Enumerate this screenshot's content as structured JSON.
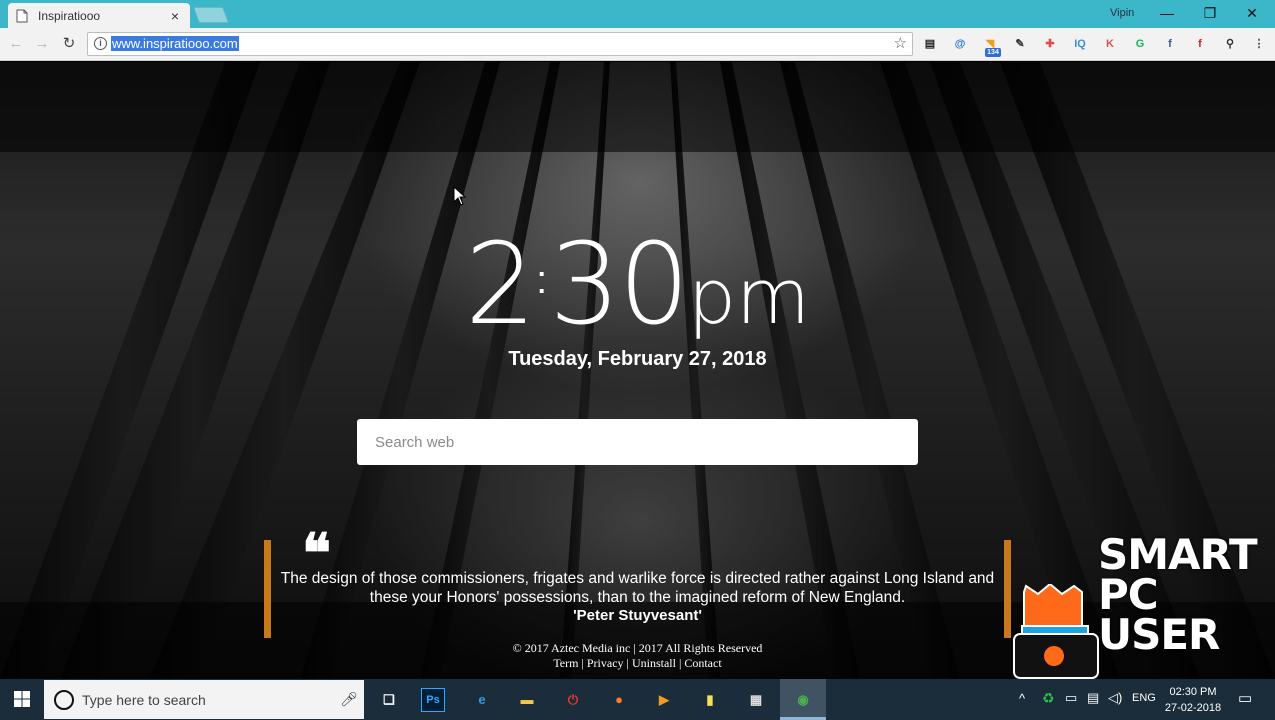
{
  "browser": {
    "tab_title": "Inspiratiooo",
    "tab_close": "×",
    "user_name": "Vipin",
    "window_controls": {
      "minimize": "—",
      "maximize": "❐",
      "close": "✕"
    },
    "url": "www.inspiratiooo.com",
    "extensions": [
      {
        "name": "layout-extension-icon",
        "glyph": "▤",
        "color": "#222222"
      },
      {
        "name": "at-extension-icon",
        "glyph": "@",
        "color": "#1e6fd9"
      },
      {
        "name": "rss-extension-icon",
        "glyph": "◥",
        "color": "#f0a01a",
        "badge": "134"
      },
      {
        "name": "eyedropper-extension-icon",
        "glyph": "✎",
        "color": "#333333"
      },
      {
        "name": "puzzle-extension-icon",
        "glyph": "✚",
        "color": "#e04a4a"
      },
      {
        "name": "iq-extension-icon",
        "glyph": "IQ",
        "color": "#3a8fd6"
      },
      {
        "name": "k-extension-icon",
        "glyph": "K",
        "color": "#e05050"
      },
      {
        "name": "grammarly-extension-icon",
        "glyph": "G",
        "color": "#16b35a"
      },
      {
        "name": "facebook-extension-icon",
        "glyph": "f",
        "color": "#3b5998"
      },
      {
        "name": "flipboard-extension-icon",
        "glyph": "f",
        "color": "#d42020"
      },
      {
        "name": "zoom-extension-icon",
        "glyph": "⚲",
        "color": "#333333"
      },
      {
        "name": "menu-icon",
        "glyph": "⋮",
        "color": "#444444"
      }
    ]
  },
  "page": {
    "clock": {
      "hour": "2",
      "colon": ":",
      "minutes": "30",
      "ampm": "pm"
    },
    "date": "Tuesday, February 27, 2018",
    "search_placeholder": "Search web",
    "quote_mark": "❝",
    "quote": "The design of those commissioners, frigates and warlike force is directed rather against Long Island and these your Honors' possessions, than to the imagined reform of New England.",
    "quote_author": "'Peter Stuyvesant'",
    "footer_copyright": "© 2017 Aztec Media inc | 2017 All Rights Reserved",
    "footer_links": [
      "Term",
      "Privacy",
      "Uninstall",
      "Contact"
    ],
    "footer_separator": " | ",
    "watermark_text": [
      "SMART",
      "PC USER"
    ]
  },
  "taskbar": {
    "search_placeholder": "Type here to search",
    "apps": [
      {
        "name": "task-view-icon",
        "glyph": "❑",
        "color": "#ffffff"
      },
      {
        "name": "photoshop-icon",
        "glyph": "Ps",
        "color": "#31a8ff"
      },
      {
        "name": "edge-icon",
        "glyph": "e",
        "color": "#3a96dd"
      },
      {
        "name": "file-explorer-icon",
        "glyph": "▬",
        "color": "#f4c74a"
      },
      {
        "name": "power-app-icon",
        "glyph": "⏻",
        "color": "#e53935"
      },
      {
        "name": "firefox-icon",
        "glyph": "●",
        "color": "#ff7b2b"
      },
      {
        "name": "media-player-icon",
        "glyph": "▶",
        "color": "#f29c1f"
      },
      {
        "name": "sticky-notes-icon",
        "glyph": "▮",
        "color": "#f7e25c"
      },
      {
        "name": "calculator-icon",
        "glyph": "▦",
        "color": "#dddddd"
      },
      {
        "name": "chrome-icon",
        "glyph": "◉",
        "color": "#4caf50"
      }
    ],
    "language": "ENG",
    "time": "02:30 PM",
    "date": "27-02-2018"
  }
}
